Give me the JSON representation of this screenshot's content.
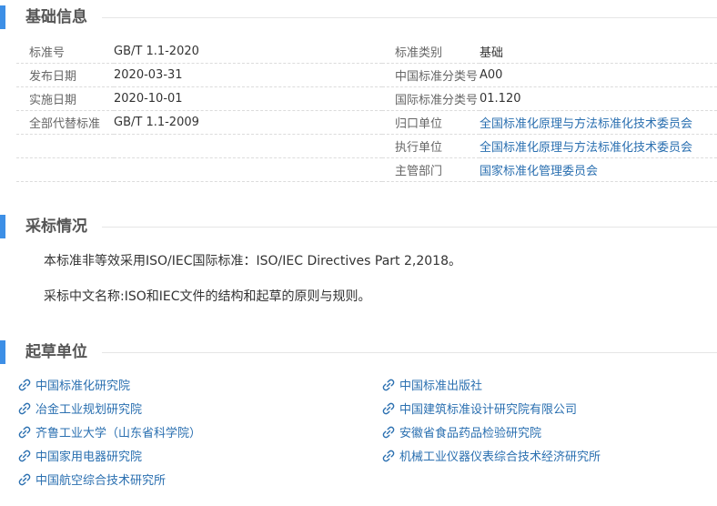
{
  "sections": {
    "basic_info": "基础信息",
    "adoption": "采标情况",
    "drafting_units": "起草单位"
  },
  "basic_info": {
    "rows": [
      {
        "l1": "标准号",
        "v1": "GB/T 1.1-2020",
        "l2": "标准类别",
        "v2": "基础"
      },
      {
        "l1": "发布日期",
        "v1": "2020-03-31",
        "l2": "中国标准分类号",
        "v2": "A00"
      },
      {
        "l1": "实施日期",
        "v1": "2020-10-01",
        "l2": "国际标准分类号",
        "v2": "01.120"
      },
      {
        "l1": "全部代替标准",
        "v1": "GB/T 1.1-2009",
        "l2": "归口单位",
        "v2": "全国标准化原理与方法标准化技术委员会"
      },
      {
        "l1": "",
        "v1": "",
        "l2": "执行单位",
        "v2": "全国标准化原理与方法标准化技术委员会"
      },
      {
        "l1": "",
        "v1": "",
        "l2": "主管部门",
        "v2": "国家标准化管理委员会"
      }
    ]
  },
  "adoption": {
    "line1": "本标准非等效采用ISO/IEC国际标准：ISO/IEC Directives Part 2,2018。",
    "line2": "采标中文名称:ISO和IEC文件的结构和起草的原则与规则。"
  },
  "drafting_units": {
    "orgs": [
      "中国标准化研究院",
      "中国标准出版社",
      "冶金工业规划研究院",
      "中国建筑标准设计研究院有限公司",
      "齐鲁工业大学（山东省科学院）",
      "安徽省食品药品检验研究院",
      "中国家用电器研究院",
      "机械工业仪器仪表综合技术经济研究所",
      "中国航空综合技术研究所"
    ]
  },
  "colors": {
    "accent": "#3d8fe6",
    "link": "#2a6fb0"
  },
  "icons": {
    "org_icon": "link-icon"
  }
}
